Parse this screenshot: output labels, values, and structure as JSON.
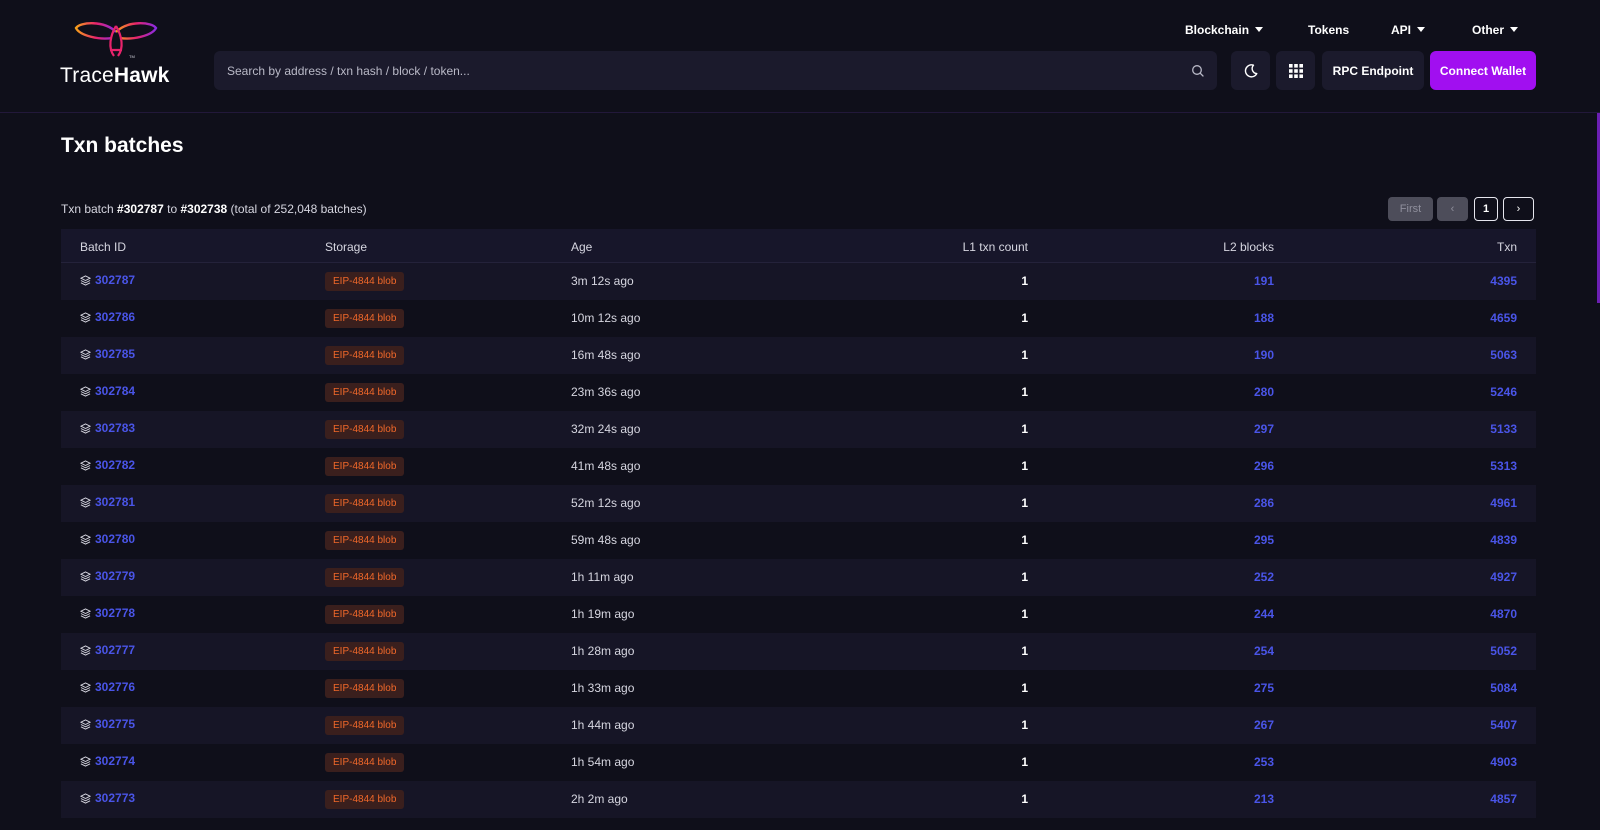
{
  "brand": {
    "name_light": "Trace",
    "name_bold": "Hawk",
    "tm": "TM"
  },
  "nav": {
    "items": [
      {
        "label": "Blockchain",
        "has_caret": true
      },
      {
        "label": "Tokens",
        "has_caret": false
      },
      {
        "label": "API",
        "has_caret": true
      },
      {
        "label": "Other",
        "has_caret": true
      }
    ]
  },
  "search": {
    "placeholder": "Search by address / txn hash / block / token...",
    "value": ""
  },
  "header_buttons": {
    "theme_icon": "moon-icon",
    "apps_icon": "grid-icon",
    "rpc_label": "RPC Endpoint",
    "connect_label": "Connect Wallet"
  },
  "page": {
    "title": "Txn batches",
    "summary": {
      "prefix": "Txn batch",
      "from": "#302787",
      "middle": "to",
      "to": "#302738",
      "suffix": "(total of 252,048 batches)"
    }
  },
  "pagination": {
    "first_label": "First",
    "prev_label": "‹",
    "current": "1",
    "next_label": "›"
  },
  "table": {
    "headers": [
      "Batch ID",
      "Storage",
      "Age",
      "L1 txn count",
      "L2 blocks",
      "Txn"
    ],
    "rows": [
      {
        "id": "302787",
        "storage": "EIP-4844 blob",
        "age": "3m 12s ago",
        "l1": "1",
        "l2": "191",
        "txn": "4395"
      },
      {
        "id": "302786",
        "storage": "EIP-4844 blob",
        "age": "10m 12s ago",
        "l1": "1",
        "l2": "188",
        "txn": "4659"
      },
      {
        "id": "302785",
        "storage": "EIP-4844 blob",
        "age": "16m 48s ago",
        "l1": "1",
        "l2": "190",
        "txn": "5063"
      },
      {
        "id": "302784",
        "storage": "EIP-4844 blob",
        "age": "23m 36s ago",
        "l1": "1",
        "l2": "280",
        "txn": "5246"
      },
      {
        "id": "302783",
        "storage": "EIP-4844 blob",
        "age": "32m 24s ago",
        "l1": "1",
        "l2": "297",
        "txn": "5133"
      },
      {
        "id": "302782",
        "storage": "EIP-4844 blob",
        "age": "41m 48s ago",
        "l1": "1",
        "l2": "296",
        "txn": "5313"
      },
      {
        "id": "302781",
        "storage": "EIP-4844 blob",
        "age": "52m 12s ago",
        "l1": "1",
        "l2": "286",
        "txn": "4961"
      },
      {
        "id": "302780",
        "storage": "EIP-4844 blob",
        "age": "59m 48s ago",
        "l1": "1",
        "l2": "295",
        "txn": "4839"
      },
      {
        "id": "302779",
        "storage": "EIP-4844 blob",
        "age": "1h 11m ago",
        "l1": "1",
        "l2": "252",
        "txn": "4927"
      },
      {
        "id": "302778",
        "storage": "EIP-4844 blob",
        "age": "1h 19m ago",
        "l1": "1",
        "l2": "244",
        "txn": "4870"
      },
      {
        "id": "302777",
        "storage": "EIP-4844 blob",
        "age": "1h 28m ago",
        "l1": "1",
        "l2": "254",
        "txn": "5052"
      },
      {
        "id": "302776",
        "storage": "EIP-4844 blob",
        "age": "1h 33m ago",
        "l1": "1",
        "l2": "275",
        "txn": "5084"
      },
      {
        "id": "302775",
        "storage": "EIP-4844 blob",
        "age": "1h 44m ago",
        "l1": "1",
        "l2": "267",
        "txn": "5407"
      },
      {
        "id": "302774",
        "storage": "EIP-4844 blob",
        "age": "1h 54m ago",
        "l1": "1",
        "l2": "253",
        "txn": "4903"
      },
      {
        "id": "302773",
        "storage": "EIP-4844 blob",
        "age": "2h 2m ago",
        "l1": "1",
        "l2": "213",
        "txn": "4857"
      }
    ]
  },
  "colors": {
    "background": "#0f0f1a",
    "accent": "#a10ff0",
    "link": "#4a55e8",
    "storage_badge_text": "#f0682a",
    "storage_badge_bg": "#3a1f1d"
  }
}
